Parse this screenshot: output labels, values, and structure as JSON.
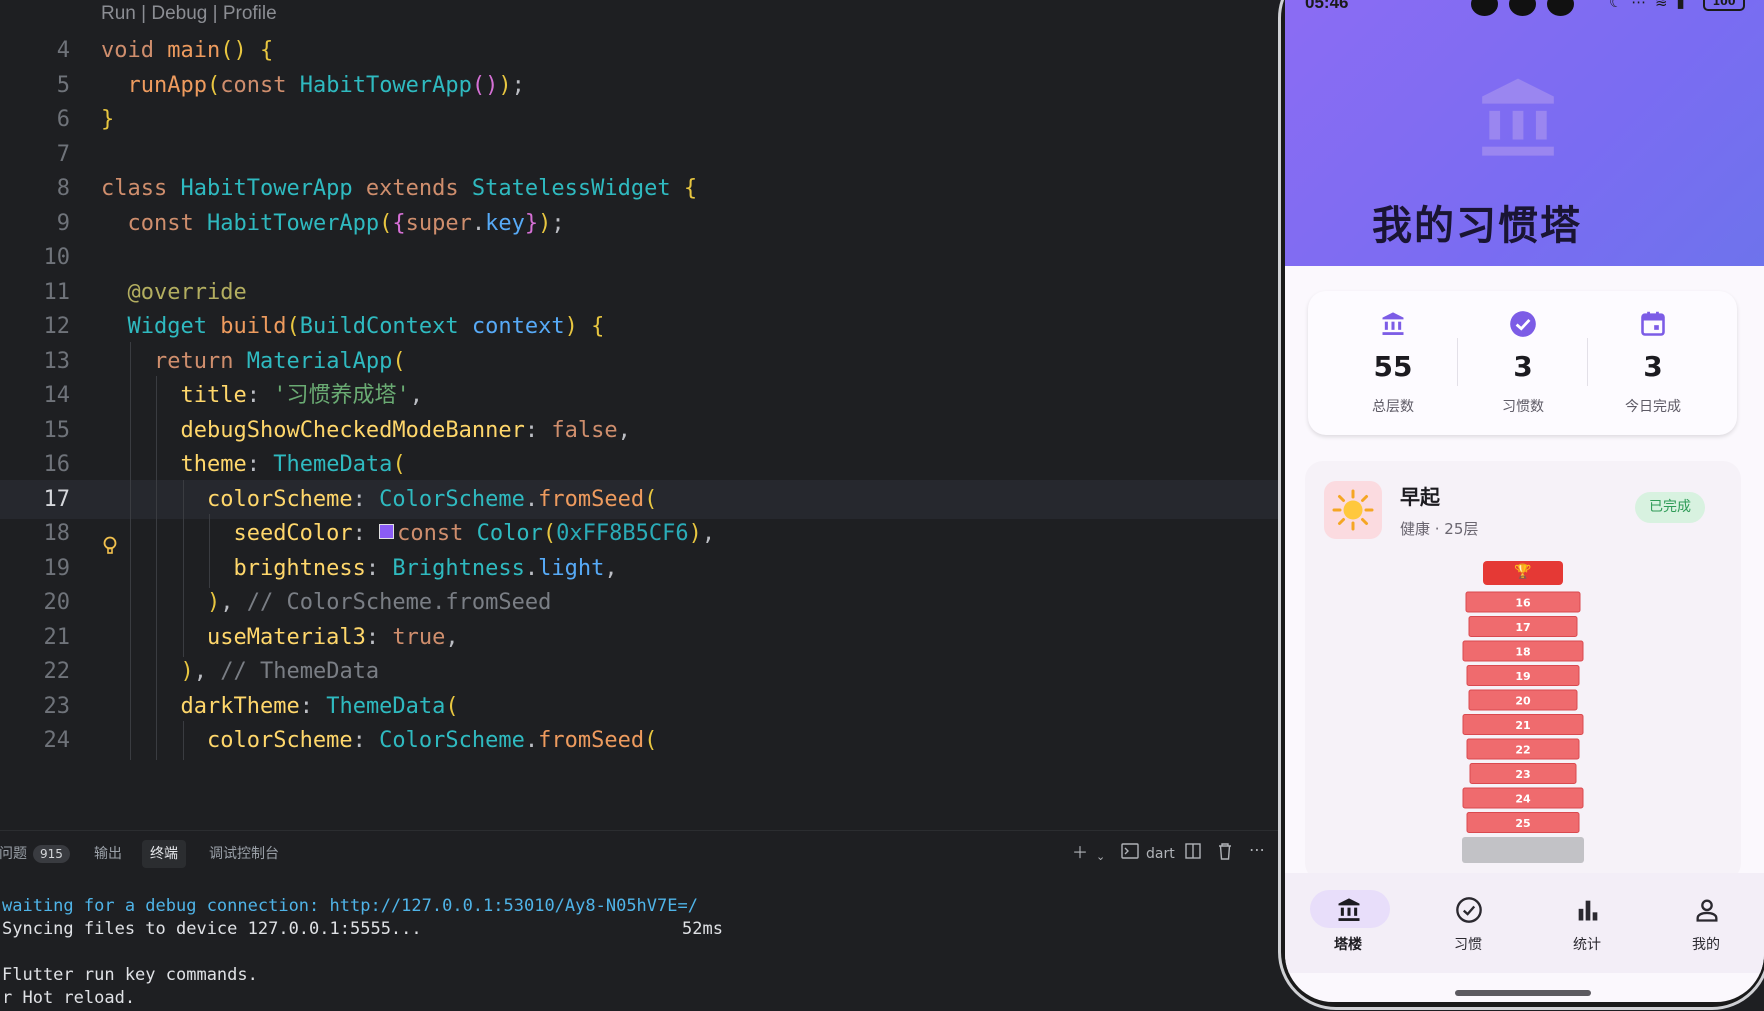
{
  "editor": {
    "codelens": "Run | Debug | Profile",
    "current_line": 17,
    "lines": [
      {
        "n": "4",
        "code": "void main() {"
      },
      {
        "n": "5",
        "code": "  runApp(const HabitTowerApp());"
      },
      {
        "n": "6",
        "code": "}"
      },
      {
        "n": "7",
        "code": ""
      },
      {
        "n": "8",
        "code": "class HabitTowerApp extends StatelessWidget {"
      },
      {
        "n": "9",
        "code": "  const HabitTowerApp({super.key});"
      },
      {
        "n": "10",
        "code": ""
      },
      {
        "n": "11",
        "code": "  @override"
      },
      {
        "n": "12",
        "code": "  Widget build(BuildContext context) {"
      },
      {
        "n": "13",
        "code": "    return MaterialApp("
      },
      {
        "n": "14",
        "code": "      title: '习惯养成塔',"
      },
      {
        "n": "15",
        "code": "      debugShowCheckedModeBanner: false,"
      },
      {
        "n": "16",
        "code": "      theme: ThemeData("
      },
      {
        "n": "17",
        "code": "        colorScheme: ColorScheme.fromSeed("
      },
      {
        "n": "18",
        "code": "          seedColor: const Color(0xFF8B5CF6),"
      },
      {
        "n": "19",
        "code": "          brightness: Brightness.light,"
      },
      {
        "n": "20",
        "code": "        ), // ColorScheme.fromSeed"
      },
      {
        "n": "21",
        "code": "        useMaterial3: true,"
      },
      {
        "n": "22",
        "code": "      ), // ThemeData"
      },
      {
        "n": "23",
        "code": "      darkTheme: ThemeData("
      },
      {
        "n": "24",
        "code": "        colorScheme: ColorScheme.fromSeed("
      }
    ]
  },
  "panel": {
    "tabs": [
      {
        "label": "问题",
        "badge": "915",
        "active": false
      },
      {
        "label": "输出",
        "active": false
      },
      {
        "label": "终端",
        "active": true
      },
      {
        "label": "调试控制台",
        "active": false
      }
    ],
    "shell_label": "dart",
    "terminal": {
      "line1_prefix": "waiting for a debug connection: ",
      "line1_link": "http://127.0.0.1:53010/Ay8-N05hV7E=/",
      "line2": "Syncing files to device 127.0.0.1:5555...",
      "line2_time": "52ms",
      "line3": "Flutter run key commands.",
      "line4": "r Hot reload."
    }
  },
  "phone": {
    "status_time": "05:46",
    "battery": "100",
    "title": "我的习惯塔",
    "stats": [
      {
        "icon": "tower-icon",
        "value": "55",
        "label": "总层数"
      },
      {
        "icon": "check-circle-icon",
        "value": "3",
        "label": "习惯数"
      },
      {
        "icon": "calendar-icon",
        "value": "3",
        "label": "今日完成"
      }
    ],
    "habit": {
      "emoji": "☀️",
      "name": "早起",
      "meta": "健康 · 25层",
      "badge": "已完成",
      "floors": [
        "16",
        "17",
        "18",
        "19",
        "20",
        "21",
        "22",
        "23",
        "24",
        "25"
      ]
    },
    "nav": [
      {
        "icon": "tower-icon",
        "label": "塔楼",
        "active": true
      },
      {
        "icon": "check-circle-icon",
        "label": "习惯",
        "active": false
      },
      {
        "icon": "bar-chart-icon",
        "label": "统计",
        "active": false
      },
      {
        "icon": "person-icon",
        "label": "我的",
        "active": false
      }
    ],
    "colors": {
      "primary": "#8b5cf6",
      "floor": "#ef6b6e",
      "top": "#e53935",
      "done": "#2f9b57"
    }
  }
}
